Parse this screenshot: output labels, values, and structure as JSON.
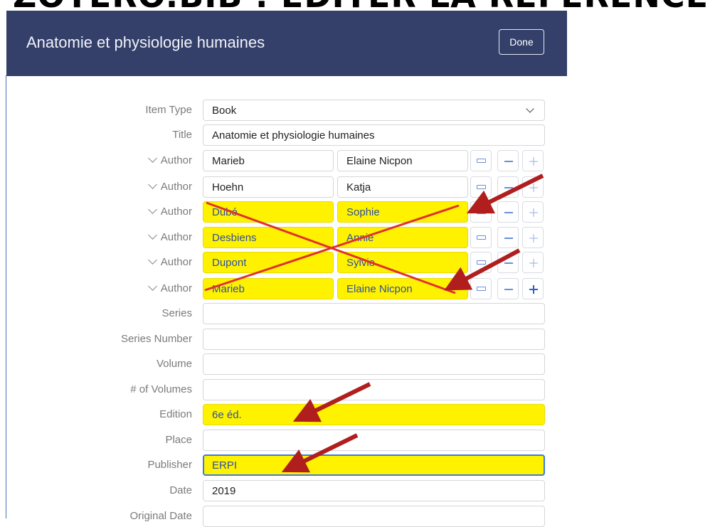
{
  "slide": {
    "title": "ZOTERO.BIB : ÉDITER LA RÉFÉRENCE"
  },
  "header": {
    "title": "Anatomie et physiologie humaines",
    "done_label": "Done"
  },
  "fields": {
    "item_type": {
      "label": "Item Type",
      "value": "Book"
    },
    "title": {
      "label": "Title",
      "value": "Anatomie et physiologie humaines"
    },
    "series": {
      "label": "Series",
      "value": ""
    },
    "series_number": {
      "label": "Series Number",
      "value": ""
    },
    "volume": {
      "label": "Volume",
      "value": ""
    },
    "num_volumes": {
      "label": "# of Volumes",
      "value": ""
    },
    "edition": {
      "label": "Edition",
      "value": "6e éd."
    },
    "place": {
      "label": "Place",
      "value": ""
    },
    "publisher": {
      "label": "Publisher",
      "value": "ERPI"
    },
    "date": {
      "label": "Date",
      "value": "2019"
    },
    "original_date": {
      "label": "Original Date",
      "value": ""
    }
  },
  "authors": [
    {
      "label": "Author",
      "last": "Marieb",
      "first": "Elaine Nicpon",
      "highlighted": false
    },
    {
      "label": "Author",
      "last": "Hoehn",
      "first": "Katja",
      "highlighted": false
    },
    {
      "label": "Author",
      "last": "Dubé",
      "first": "Sophie",
      "highlighted": true
    },
    {
      "label": "Author",
      "last": "Desbiens",
      "first": "Annie",
      "highlighted": true
    },
    {
      "label": "Author",
      "last": "Dupont",
      "first": "Sylvie",
      "highlighted": true
    },
    {
      "label": "Author",
      "last": "Marieb",
      "first": "Elaine Nicpon",
      "highlighted": true
    }
  ],
  "icons": {
    "swap": "switch-name-format-icon",
    "remove": "minus-icon",
    "add": "plus-icon",
    "dropdown": "chevron-down-icon",
    "expand": "chevron-down-icon"
  },
  "colors": {
    "header_bg": "#34406a",
    "highlight": "#fff200",
    "annotation_red": "#b01e1e",
    "cross_red": "#e0312f",
    "focus_border": "#3d7be0"
  }
}
